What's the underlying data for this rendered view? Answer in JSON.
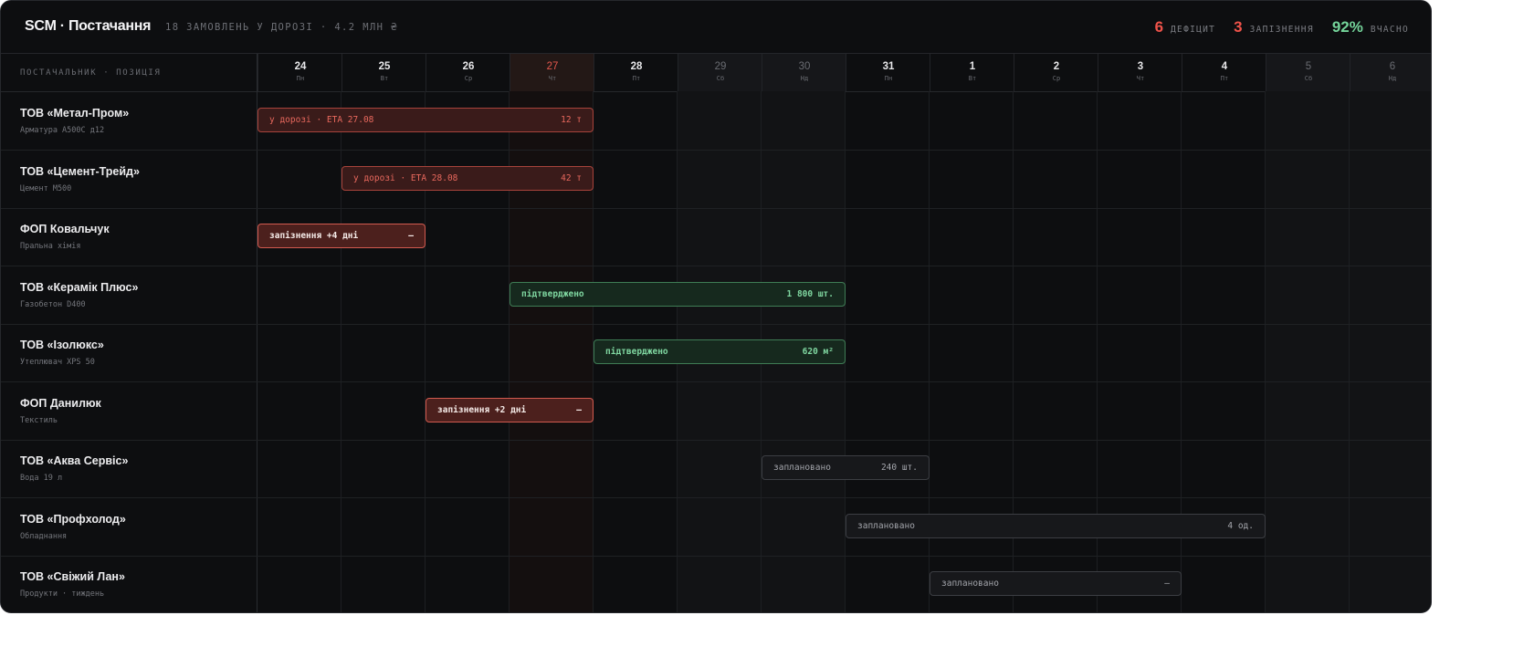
{
  "header": {
    "brand": "SCM · Постачання",
    "subtitle": "18 ЗАМОВЛЕНЬ У ДОРОЗІ · 4.2 МЛН ₴"
  },
  "stats": [
    {
      "value": "6",
      "label": "ДЕФІЦИТ",
      "color": "#f0534a"
    },
    {
      "value": "3",
      "label": "ЗАПІЗНЕННЯ",
      "color": "#f0534a"
    },
    {
      "value": "92%",
      "label": "ВЧАСНО",
      "color": "#74d49a"
    }
  ],
  "grid": {
    "column_header": "ПОСТАЧАЛЬНИК · ПОЗИЦІЯ",
    "days": [
      {
        "num": "24",
        "wd": "Пн",
        "kind": "normal"
      },
      {
        "num": "25",
        "wd": "Вт",
        "kind": "normal"
      },
      {
        "num": "26",
        "wd": "Ср",
        "kind": "normal"
      },
      {
        "num": "27",
        "wd": "Чт",
        "kind": "today"
      },
      {
        "num": "28",
        "wd": "Пт",
        "kind": "normal"
      },
      {
        "num": "29",
        "wd": "Сб",
        "kind": "weekend"
      },
      {
        "num": "30",
        "wd": "Нд",
        "kind": "weekend"
      },
      {
        "num": "31",
        "wd": "Пн",
        "kind": "normal"
      },
      {
        "num": "1",
        "wd": "Вт",
        "kind": "normal"
      },
      {
        "num": "2",
        "wd": "Ср",
        "kind": "normal"
      },
      {
        "num": "3",
        "wd": "Чт",
        "kind": "normal"
      },
      {
        "num": "4",
        "wd": "Пт",
        "kind": "normal"
      },
      {
        "num": "5",
        "wd": "Сб",
        "kind": "weekend"
      },
      {
        "num": "6",
        "wd": "Нд",
        "kind": "weekend"
      }
    ]
  },
  "rows": [
    {
      "name": "ТОВ «Метал-Пром»",
      "item": "Арматура А500С д12",
      "bar": {
        "status": "transit",
        "label": "у дорозі · ETA 27.08",
        "qty": "12 т",
        "start_day": "24",
        "end_day": "27"
      }
    },
    {
      "name": "ТОВ «Цемент-Трейд»",
      "item": "Цемент М500",
      "bar": {
        "status": "transit",
        "label": "у дорозі · ETA 28.08",
        "qty": "42 т",
        "start_day": "25",
        "end_day": "27"
      }
    },
    {
      "name": "ФОП Ковальчук",
      "item": "Пральна хімія",
      "bar": {
        "status": "late",
        "label": "запізнення +4 дні",
        "qty": "—",
        "start_day": "24",
        "end_day": "25"
      }
    },
    {
      "name": "ТОВ «Керамік Плюс»",
      "item": "Газобетон D400",
      "bar": {
        "status": "ok",
        "label": "підтверджено",
        "qty": "1 800 шт.",
        "start_day": "27",
        "end_day": "30"
      }
    },
    {
      "name": "ТОВ «Ізолюкс»",
      "item": "Утеплювач XPS 50",
      "bar": {
        "status": "ok",
        "label": "підтверджено",
        "qty": "620 м²",
        "start_day": "28",
        "end_day": "30"
      }
    },
    {
      "name": "ФОП Данилюк",
      "item": "Текстиль",
      "bar": {
        "status": "late",
        "label": "запізнення +2 дні",
        "qty": "—",
        "start_day": "26",
        "end_day": "27"
      }
    },
    {
      "name": "ТОВ «Аква Сервіс»",
      "item": "Вода 19 л",
      "bar": {
        "status": "plan",
        "label": "заплановано",
        "qty": "240 шт.",
        "start_day": "30",
        "end_day": "31"
      }
    },
    {
      "name": "ТОВ «Профхолод»",
      "item": "Обладнання",
      "bar": {
        "status": "plan",
        "label": "заплановано",
        "qty": "4 од.",
        "start_day": "31",
        "end_day": "4"
      }
    },
    {
      "name": "ТОВ «Свіжий Лан»",
      "item": "Продукти · тиждень",
      "bar": {
        "status": "plan",
        "label": "заплановано",
        "qty": "—",
        "start_day": "1",
        "end_day": "3"
      }
    }
  ]
}
